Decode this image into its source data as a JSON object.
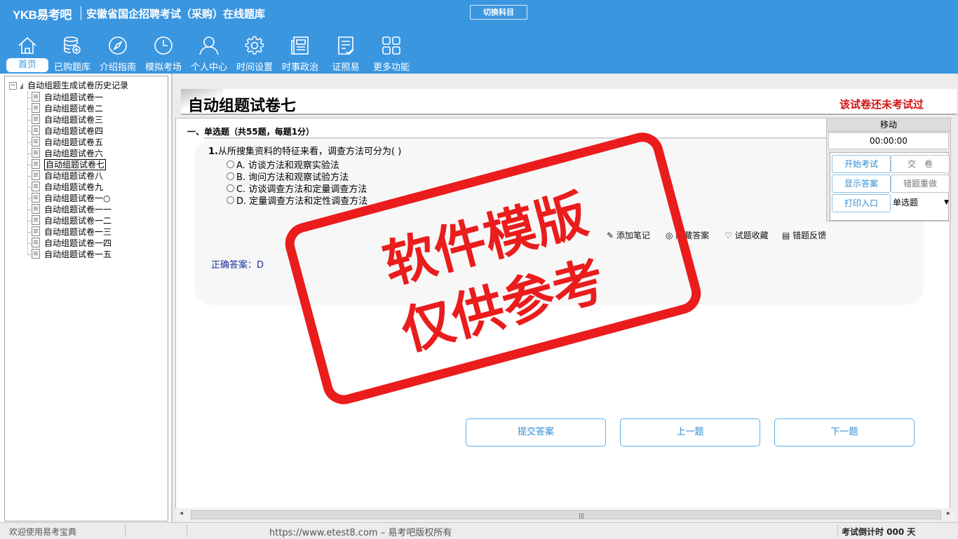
{
  "header": {
    "brand": "YKB易考吧",
    "title": "安徽省国企招聘考试（采购）在线题库",
    "switch_subject": "切换科目"
  },
  "nav": [
    {
      "label": "首页",
      "icon": "home-icon"
    },
    {
      "label": "已购题库",
      "icon": "database-icon"
    },
    {
      "label": "介绍指南",
      "icon": "compass-icon"
    },
    {
      "label": "模拟考场",
      "icon": "clock-icon"
    },
    {
      "label": "个人中心",
      "icon": "user-icon"
    },
    {
      "label": "时间设置",
      "icon": "gear-icon"
    },
    {
      "label": "时事政治",
      "icon": "newspaper-icon"
    },
    {
      "label": "证照易",
      "icon": "checklist-icon"
    },
    {
      "label": "更多功能",
      "icon": "grid-icon"
    }
  ],
  "tree": {
    "root": "自动组题生成试卷历史记录",
    "items": [
      "自动组题试卷一",
      "自动组题试卷二",
      "自动组题试卷三",
      "自动组题试卷四",
      "自动组题试卷五",
      "自动组题试卷六",
      "自动组题试卷七",
      "自动组题试卷八",
      "自动组题试卷九",
      "自动组题试卷一○",
      "自动组题试卷一一",
      "自动组题试卷一二",
      "自动组题试卷一三",
      "自动组题试卷一四",
      "自动组题试卷一五"
    ],
    "selected_index": 6
  },
  "paper": {
    "title": "自动组题试卷七",
    "status": "该试卷还未考试过",
    "section": "一、单选题（共55题，每题1分）"
  },
  "question": {
    "number": "1.",
    "text": "从所搜集资料的特征来看，调查方法可分为( )",
    "options": [
      "A. 访谈方法和观察实验法",
      "B. 询问方法和观察试验方法",
      "C. 访谈调查方法和定量调查方法",
      "D. 定量调查方法和定性调查方法"
    ],
    "tools": [
      "添加笔记",
      "隐藏答案",
      "试题收藏",
      "错题反馈"
    ],
    "answer": "正确答案：D"
  },
  "buttons": {
    "submit": "提交答案",
    "prev": "上一题",
    "next": "下一题"
  },
  "side": {
    "move": "移动",
    "timer": "00:00:00",
    "start": "开始考试",
    "hand_in": "交　卷",
    "show_answer": "显示答案",
    "wrong_redo": "错题重做",
    "print": "打印入口",
    "type": "单选题"
  },
  "status_bar": {
    "welcome": "欢迎使用易考宝典",
    "copyright": "https://www.etest8.com – 易考吧版权所有",
    "countdown": "考试倒计时 000 天"
  },
  "watermark": {
    "line1": "软件模版",
    "line2": "仅供参考"
  },
  "colors": {
    "header": "#3b96e0",
    "status_red": "#d11111",
    "stamp": "#ea1c1c",
    "answer_blue": "#1b2f9a"
  }
}
